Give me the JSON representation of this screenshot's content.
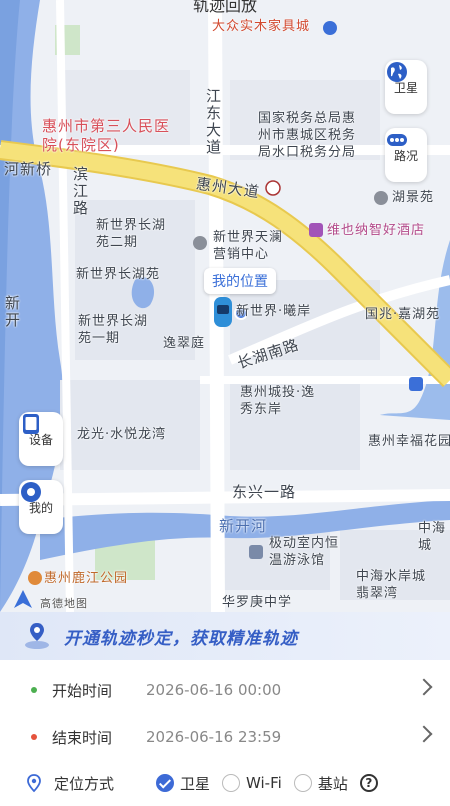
{
  "header": {
    "title": "轨迹回放"
  },
  "map": {
    "labels": {
      "furniture": "大众实木家具城",
      "jiangdong": "江东大道",
      "tax": "国家税务总局惠州市惠城区税务局水口税务分局",
      "hospital": "惠州市第三人民医院(东院区)",
      "hexin_bridge": "河新桥",
      "binjiang": "滨江路",
      "huizhou_ave": "惠州大道",
      "hujing": "湖景苑",
      "hotel": "维也纳智好酒店",
      "xsj_erqi": "新世界长湖苑二期",
      "xsj_tianlan": "新世界天澜营销中心",
      "xsj_changhu": "新世界长湖苑",
      "xsj_xian": "新世界·曦岸",
      "guozhao": "国兆·嘉湖苑",
      "xsj_yiqi": "新世界长湖苑一期",
      "yicui": "逸翠庭",
      "changhu_south": "长湖南路",
      "chengtou": "惠州城投·逸秀东岸",
      "xingfu": "惠州幸福花园",
      "longguang": "龙光·水悦龙湾",
      "dongxing": "东兴一路",
      "xinkai": "新开河",
      "jidong": "极动室内恒温游泳馆",
      "zhonghai_city": "中海城",
      "zhonghai_shui": "中海水岸城翡翠湾",
      "lujiang": "惠州鹿江公园",
      "hualuogeng": "华罗庚中学",
      "xinkai_left": "新开",
      "map_brand": "高德地图"
    },
    "my_location": "我的位置"
  },
  "controls": {
    "satellite": "卫星",
    "traffic": "路况",
    "device": "设备",
    "mine": "我的"
  },
  "banner": {
    "text": "开通轨迹秒定，获取精准轨迹"
  },
  "form": {
    "start_label": "开始时间",
    "start_value": "2026-06-16 00:00",
    "end_label": "结束时间",
    "end_value": "2026-06-16 23:59",
    "mode_label": "定位方式",
    "options": [
      "卫星",
      "Wi-Fi",
      "基站"
    ]
  },
  "colors": {
    "accent": "#3d6ad6",
    "start_dot": "#4caf50",
    "end_dot": "#e5533d",
    "main_road": "#f6e27a"
  }
}
